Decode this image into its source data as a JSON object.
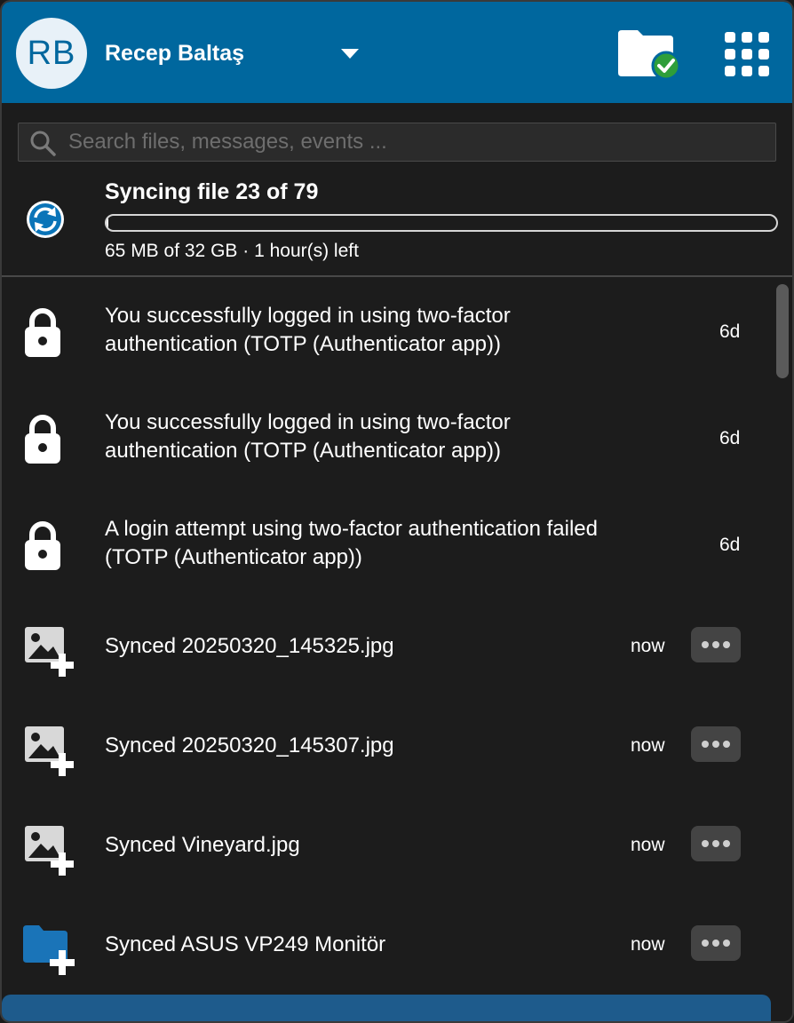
{
  "account": {
    "initials": "RB",
    "name": "Recep Baltaş"
  },
  "search": {
    "placeholder": "Search files, messages, events ..."
  },
  "sync": {
    "title": "Syncing file 23 of 79",
    "progress_fraction": 0.002,
    "details": "65 MB of 32 GB · 1 hour(s) left"
  },
  "activities": [
    {
      "icon": "lock-icon",
      "line1": "You successfully logged in using two-factor",
      "line2": "authentication (TOTP (Authenticator app))",
      "time": "6d"
    },
    {
      "icon": "lock-icon",
      "line1": "You successfully logged in using two-factor",
      "line2": "authentication (TOTP (Authenticator app))",
      "time": "6d"
    },
    {
      "icon": "lock-icon",
      "line1": "A login attempt using two-factor authentication failed",
      "line2": "(TOTP (Authenticator app))",
      "time": "6d"
    },
    {
      "icon": "image-add-icon",
      "line1": "Synced 20250320_145325.jpg",
      "time": "now"
    },
    {
      "icon": "image-add-icon",
      "line1": "Synced 20250320_145307.jpg",
      "time": "now"
    },
    {
      "icon": "image-add-icon",
      "line1": "Synced Vineyard.jpg",
      "time": "now"
    },
    {
      "icon": "folder-add-icon",
      "line1": "Synced ASUS VP249 Monitör",
      "time": "now"
    }
  ],
  "colors": {
    "header": "#00679e",
    "background": "#1c1c1c",
    "accent_green": "#2e9e3a"
  }
}
